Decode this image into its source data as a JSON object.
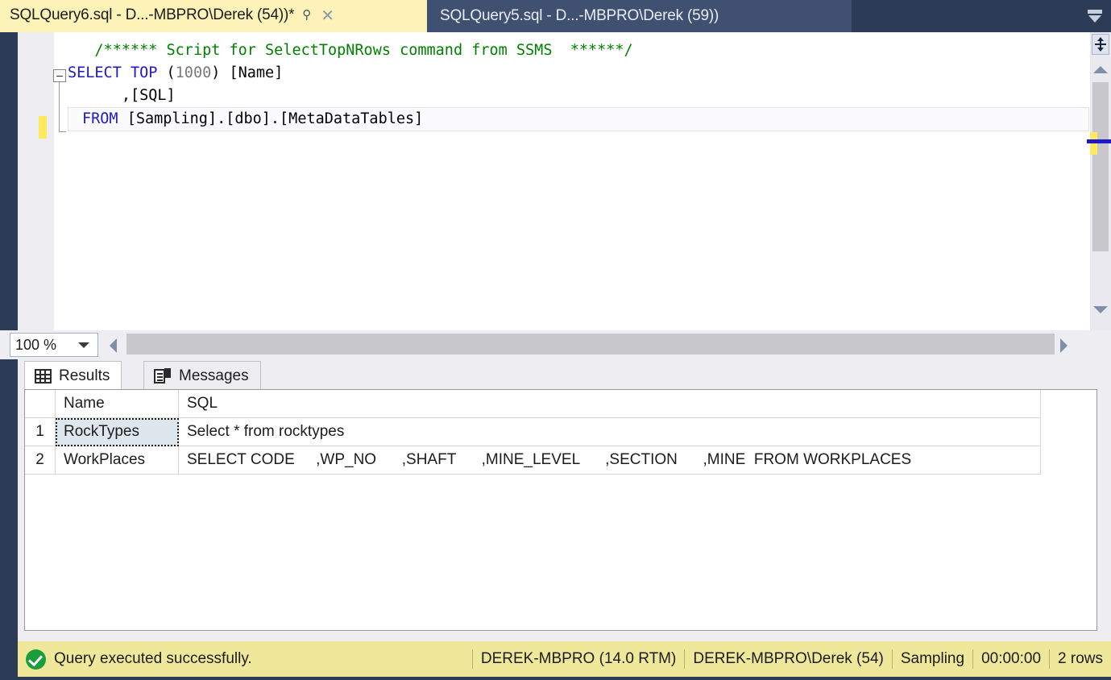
{
  "tabs": {
    "active": {
      "title": "SQLQuery6.sql - D...-MBPRO\\Derek (54))*",
      "pin_icon": "pin-icon",
      "close_icon": "close-icon"
    },
    "inactive": {
      "title": "SQLQuery5.sql - D...-MBPRO\\Derek (59))"
    },
    "overflow_icon": "tab-overflow-chevron-icon"
  },
  "editor": {
    "lines": [
      {
        "id": "line-comment",
        "segments": [
          {
            "cls": "c-plain",
            "text": "   "
          },
          {
            "cls": "c-comment",
            "text": "/****** Script for SelectTopNRows command from SSMS  ******/"
          }
        ]
      },
      {
        "id": "line-select",
        "segments": [
          {
            "cls": "c-kw",
            "text": "SELECT"
          },
          {
            "cls": "c-plain",
            "text": " "
          },
          {
            "cls": "c-kw",
            "text": "TOP"
          },
          {
            "cls": "c-plain",
            "text": " ("
          },
          {
            "cls": "c-num",
            "text": "1000"
          },
          {
            "cls": "c-plain",
            "text": ") [Name]"
          }
        ]
      },
      {
        "id": "line-sqlcol",
        "segments": [
          {
            "cls": "c-plain",
            "text": "      ,[SQL]"
          }
        ]
      }
    ],
    "current_line": {
      "id": "line-from",
      "segments": [
        {
          "cls": "c-kw",
          "text": "FROM"
        },
        {
          "cls": "c-plain",
          "text": " [Sampling].[dbo].[MetaDataTables]"
        }
      ]
    },
    "full_text": "   /****** Script for SelectTopNRows command from SSMS  ******/\nSELECT TOP (1000) [Name]\n      ,[SQL]\n  FROM [Sampling].[dbo].[MetaDataTables]",
    "split_button_icon": "split-pane-icon",
    "scroll_up_icon": "scroll-up-arrow-icon",
    "scroll_down_icon": "scroll-down-arrow-icon",
    "colors": {
      "comment": "#008000",
      "keyword": "#1f18c4",
      "number": "#7a7a7a",
      "change_bar": "#ffe95c",
      "caret_marker": "#1f18c4"
    }
  },
  "zoombar": {
    "zoom_value": "100 %",
    "dropdown_icon": "chevron-down-icon",
    "hscroll_left_icon": "scroll-left-arrow-icon",
    "hscroll_right_icon": "scroll-right-arrow-icon"
  },
  "results": {
    "tabs": [
      {
        "label": "Results",
        "icon": "grid-icon",
        "active": true
      },
      {
        "label": "Messages",
        "icon": "message-document-icon",
        "active": false
      }
    ],
    "columns": [
      "",
      "Name",
      "SQL"
    ],
    "rows": [
      {
        "num": "1",
        "name": "RockTypes",
        "sql": "Select * from rocktypes",
        "selected_cell": "name"
      },
      {
        "num": "2",
        "name": "WorkPlaces",
        "sql": "SELECT CODE     ,WP_NO      ,SHAFT      ,MINE_LEVEL      ,SECTION      ,MINE  FROM WORKPLACES",
        "selected_cell": ""
      }
    ]
  },
  "statusbar": {
    "icon": "success-check-icon",
    "message": "Query executed successfully.",
    "server": "DEREK-MBPRO (14.0 RTM)",
    "user": "DEREK-MBPRO\\Derek (54)",
    "database": "Sampling",
    "elapsed": "00:00:00",
    "rowcount": "2 rows",
    "background_color": "#efe79a"
  }
}
